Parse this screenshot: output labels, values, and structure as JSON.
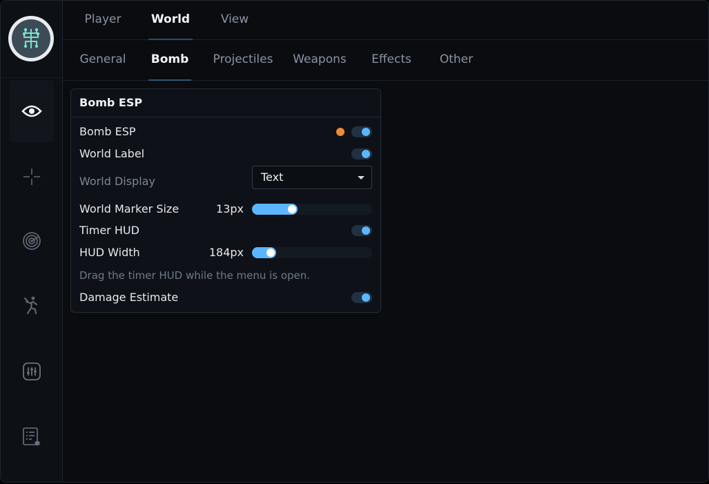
{
  "tabs_primary": [
    {
      "label": "Player",
      "active": false
    },
    {
      "label": "World",
      "active": true
    },
    {
      "label": "View",
      "active": false
    }
  ],
  "tabs_secondary": [
    {
      "label": "General",
      "active": false
    },
    {
      "label": "Bomb",
      "active": true
    },
    {
      "label": "Projectiles",
      "active": false
    },
    {
      "label": "Weapons",
      "active": false
    },
    {
      "label": "Effects",
      "active": false
    },
    {
      "label": "Other",
      "active": false
    }
  ],
  "sidebar": {
    "logo_icon": "brain-circuit-logo-icon",
    "items": [
      {
        "icon": "eye-icon",
        "active": true
      },
      {
        "icon": "crosshair-icon",
        "active": false
      },
      {
        "icon": "radar-icon",
        "active": false
      },
      {
        "icon": "running-person-icon",
        "active": false
      },
      {
        "icon": "sliders-icon",
        "active": false
      },
      {
        "icon": "debug-list-icon",
        "active": false
      }
    ]
  },
  "panel": {
    "title": "Bomb ESP",
    "bomb_esp": {
      "label": "Bomb ESP",
      "enabled": true,
      "color": "#ee8c34"
    },
    "world_label": {
      "label": "World Label",
      "enabled": true
    },
    "world_display": {
      "label": "World Display",
      "value": "Text"
    },
    "world_marker_size": {
      "label": "World Marker Size",
      "value_text": "13px",
      "value": 13,
      "fill_fraction": 0.38
    },
    "timer_hud": {
      "label": "Timer HUD",
      "enabled": true
    },
    "hud_width": {
      "label": "HUD Width",
      "value_text": "184px",
      "value": 184,
      "fill_fraction": 0.2
    },
    "hint": "Drag the timer HUD while the menu is open.",
    "damage_estimate": {
      "label": "Damage Estimate",
      "enabled": true
    }
  },
  "colors": {
    "accent": "#5cb6ff",
    "bomb_color": "#ee8c34",
    "background": "#0a0c10"
  }
}
